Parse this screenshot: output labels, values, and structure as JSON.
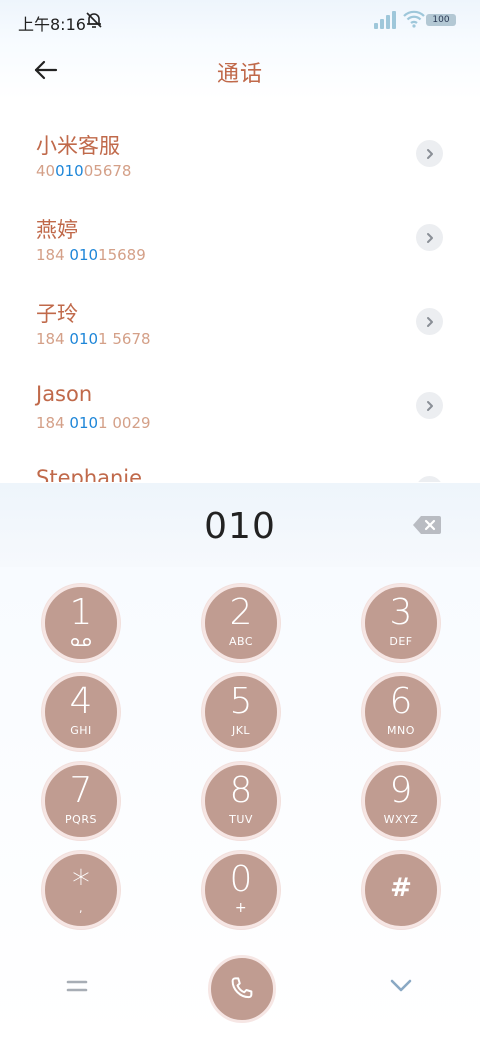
{
  "status_bar": {
    "time": "上午8:16",
    "battery": "100",
    "icons": [
      "bell-muted-icon",
      "signal-icon",
      "wifi-icon",
      "battery-icon"
    ]
  },
  "header": {
    "title": "通话",
    "back_icon": "arrow-left-icon"
  },
  "contacts": [
    {
      "name": "小米客服",
      "num_pre": "40",
      "num_hl": "010",
      "num_post": "05678"
    },
    {
      "name": "燕婷",
      "num_pre": "184 ",
      "num_hl": "010",
      "num_post": "15689"
    },
    {
      "name": "子玲",
      "num_pre": "184 ",
      "num_hl": "010",
      "num_post": "1 5678"
    },
    {
      "name": "Jason",
      "num_pre": "184 ",
      "num_hl": "010",
      "num_post": "1 0029"
    },
    {
      "name": "Stephanie",
      "num_pre": "",
      "num_hl": "",
      "num_post": ""
    }
  ],
  "dial": {
    "digits": "010"
  },
  "keypad": [
    {
      "digit": "1",
      "letters": ""
    },
    {
      "digit": "2",
      "letters": "ABC"
    },
    {
      "digit": "3",
      "letters": "DEF"
    },
    {
      "digit": "4",
      "letters": "GHI"
    },
    {
      "digit": "5",
      "letters": "JKL"
    },
    {
      "digit": "6",
      "letters": "MNO"
    },
    {
      "digit": "7",
      "letters": "PQRS"
    },
    {
      "digit": "8",
      "letters": "TUV"
    },
    {
      "digit": "9",
      "letters": "WXYZ"
    },
    {
      "digit": "*",
      "letters": ","
    },
    {
      "digit": "0",
      "letters": "+"
    },
    {
      "digit": "#",
      "letters": ""
    }
  ],
  "colors": {
    "accent": "#c0694a",
    "highlight": "#1e86d8",
    "key": "#c09c91"
  }
}
